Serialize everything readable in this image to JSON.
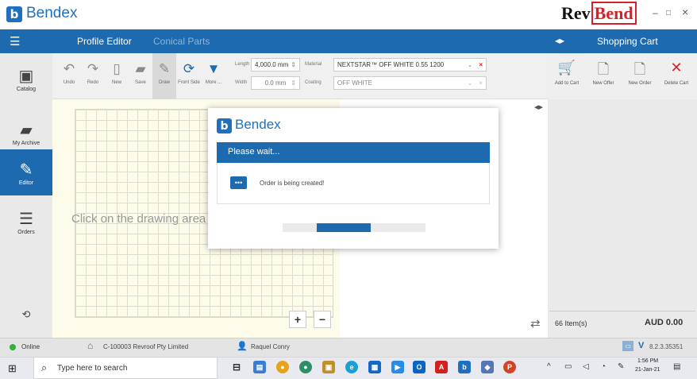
{
  "app": {
    "name": "Bendex",
    "logo_letter": "b",
    "brand": "RevBend",
    "brand_prefix": "Rev",
    "brand_suffix": "Bend"
  },
  "window_controls": {
    "minimize": "–",
    "maximize": "□",
    "close": "×"
  },
  "nav": {
    "menu_icon": "☰",
    "tabs": [
      {
        "label": "Profile Editor",
        "active": true
      },
      {
        "label": "Conical Parts",
        "active": false
      }
    ]
  },
  "cart": {
    "arrows_icon": "◂▸",
    "title": "Shopping Cart",
    "buttons": [
      {
        "label": "Add to Cart",
        "icon": "cart-icon"
      },
      {
        "label": "New Offer",
        "icon": "offer-icon"
      },
      {
        "label": "New Order",
        "icon": "order-icon"
      },
      {
        "label": "Delete Cart",
        "icon": "delete-cart-icon"
      }
    ],
    "item_count": "66 Item(s)",
    "total": "AUD 0.00"
  },
  "sidebar": {
    "items": [
      {
        "label": "Catalog",
        "icon": "catalog-icon"
      },
      {
        "label": "My Archive",
        "icon": "folder-icon"
      },
      {
        "label": "Editor",
        "icon": "pencil-icon",
        "active": true
      },
      {
        "label": "Orders",
        "icon": "orders-icon"
      }
    ],
    "bottom_icon": "refresh-icon"
  },
  "toolbar": {
    "buttons": [
      {
        "label": "Undo"
      },
      {
        "label": "Redo"
      },
      {
        "label": "New"
      },
      {
        "label": "Save"
      },
      {
        "label": "Draw"
      },
      {
        "label": "Front Side"
      },
      {
        "label": "More ..."
      }
    ],
    "length_label": "Length",
    "length_value": "4,000.0 mm",
    "width_label": "Width",
    "width_value": "0.0 mm",
    "material_label": "Material",
    "material_value": "NEXTSTAR™ OFF WHITE 0.55 1200",
    "coating_label": "Coating",
    "coating_value": "OFF WHITE"
  },
  "drawing": {
    "hint": "Click on the drawing area and",
    "zoom_in": "+",
    "zoom_out": "−"
  },
  "modal": {
    "brand": "Bendex",
    "header": "Please wait...",
    "message": "Order is being created!",
    "progress": 0.38
  },
  "status": {
    "online": "Online",
    "company": "C-100003 Revroof Pty Limited",
    "user": "Raquel Conry",
    "version": "8.2.3.35351",
    "version_logo": "V"
  },
  "taskbar": {
    "search_placeholder": "Type here to search",
    "time": "1:56 PM",
    "date": "21-Jan-21"
  },
  "colors": {
    "primary": "#1e6aae",
    "brand_red": "#d8202a",
    "online": "#2fb33b"
  }
}
